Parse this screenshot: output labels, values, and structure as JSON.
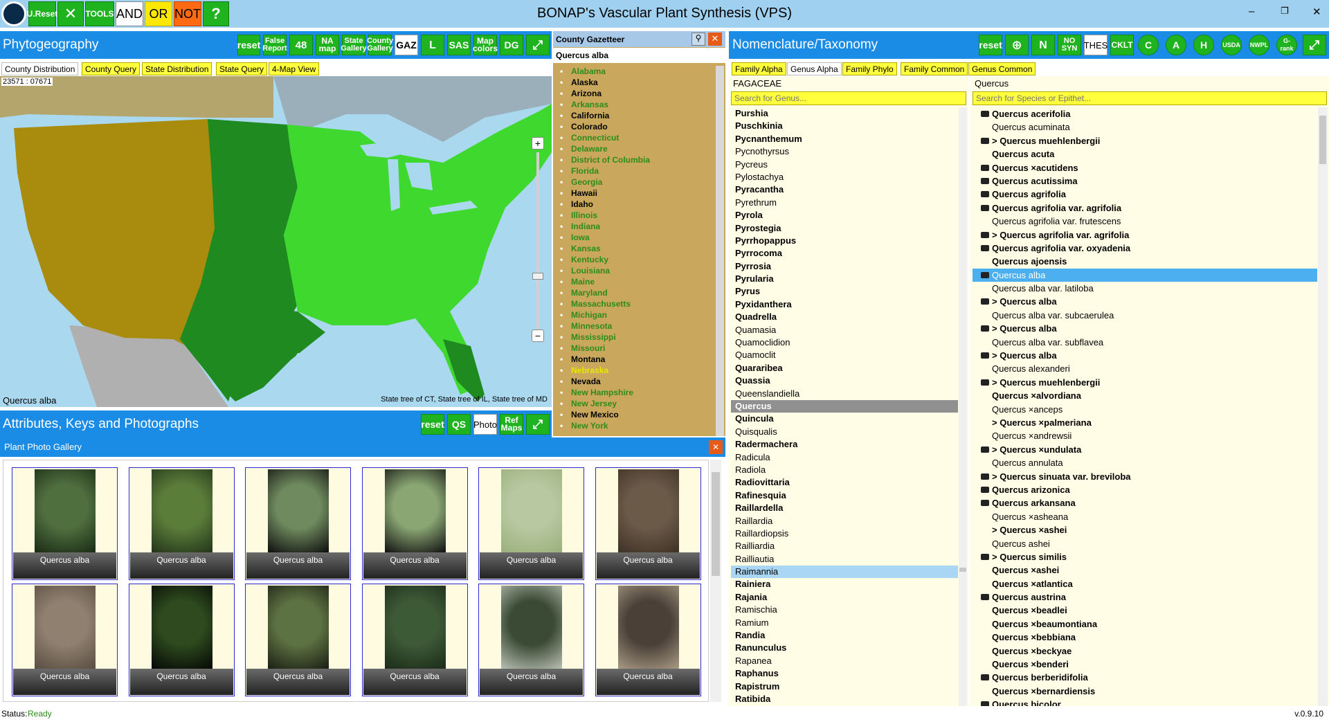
{
  "app": {
    "title": "BONAP's Vascular Plant Synthesis (VPS)",
    "version": "v.0.9.10"
  },
  "toolbar": {
    "ureset": "U.Reset",
    "tools": "TOOLS",
    "and": "AND",
    "or": "OR",
    "not": "NOT",
    "help": "?"
  },
  "window_controls": {
    "minimize": "–",
    "restore": "❐",
    "close": "✕"
  },
  "phyto": {
    "title": "Phytogeography",
    "buttons": [
      "reset",
      "False Report",
      "48",
      "NA map",
      "State Gallery",
      "County Gallery",
      "GAZ",
      "L",
      "SAS",
      "Map colors",
      "DG"
    ],
    "tabs": [
      "County Distribution",
      "County Query",
      "State Distribution",
      "State Query",
      "4-Map View"
    ],
    "coords": "23571 : 07671",
    "species": "Quercus alba",
    "note": "State tree of CT, State tree of IL, State tree of MD"
  },
  "gazetteer": {
    "title": "County Gazetteer",
    "species": "Quercus alba",
    "states": [
      {
        "name": "Alabama",
        "c": "#2e8b1a"
      },
      {
        "name": "Alaska",
        "c": "#000"
      },
      {
        "name": "Arizona",
        "c": "#000"
      },
      {
        "name": "Arkansas",
        "c": "#2e8b1a"
      },
      {
        "name": "California",
        "c": "#000"
      },
      {
        "name": "Colorado",
        "c": "#000"
      },
      {
        "name": "Connecticut",
        "c": "#2e8b1a"
      },
      {
        "name": "Delaware",
        "c": "#2e8b1a"
      },
      {
        "name": "District of Columbia",
        "c": "#2e8b1a"
      },
      {
        "name": "Florida",
        "c": "#2e8b1a"
      },
      {
        "name": "Georgia",
        "c": "#2e8b1a"
      },
      {
        "name": "Hawaii",
        "c": "#000"
      },
      {
        "name": "Idaho",
        "c": "#000"
      },
      {
        "name": "Illinois",
        "c": "#2e8b1a"
      },
      {
        "name": "Indiana",
        "c": "#2e8b1a"
      },
      {
        "name": "Iowa",
        "c": "#2e8b1a"
      },
      {
        "name": "Kansas",
        "c": "#2e8b1a"
      },
      {
        "name": "Kentucky",
        "c": "#2e8b1a"
      },
      {
        "name": "Louisiana",
        "c": "#2e8b1a"
      },
      {
        "name": "Maine",
        "c": "#2e8b1a"
      },
      {
        "name": "Maryland",
        "c": "#2e8b1a"
      },
      {
        "name": "Massachusetts",
        "c": "#2e8b1a"
      },
      {
        "name": "Michigan",
        "c": "#2e8b1a"
      },
      {
        "name": "Minnesota",
        "c": "#2e8b1a"
      },
      {
        "name": "Mississippi",
        "c": "#2e8b1a"
      },
      {
        "name": "Missouri",
        "c": "#2e8b1a"
      },
      {
        "name": "Montana",
        "c": "#000"
      },
      {
        "name": "Nebraska",
        "c": "#e8e800"
      },
      {
        "name": "Nevada",
        "c": "#000"
      },
      {
        "name": "New Hampshire",
        "c": "#2e8b1a"
      },
      {
        "name": "New Jersey",
        "c": "#2e8b1a"
      },
      {
        "name": "New Mexico",
        "c": "#000"
      },
      {
        "name": "New York",
        "c": "#2e8b1a"
      }
    ]
  },
  "attributes": {
    "title": "Attributes, Keys and Photographs",
    "buttons": [
      "reset",
      "QS",
      "Photo",
      "Ref Maps"
    ]
  },
  "gallery": {
    "title": "Plant Photo Gallery",
    "photos": [
      {
        "caption": "Quercus alba",
        "c1": "#4f6f3f",
        "c2": "#1a2a14"
      },
      {
        "caption": "Quercus alba",
        "c1": "#5a7d3a",
        "c2": "#24341a"
      },
      {
        "caption": "Quercus alba",
        "c1": "#6f8a5e",
        "c2": "#0e0e0e"
      },
      {
        "caption": "Quercus alba",
        "c1": "#8aa673",
        "c2": "#101010"
      },
      {
        "caption": "Quercus alba",
        "c1": "#b8c8a0",
        "c2": "#9ab07c"
      },
      {
        "caption": "Quercus alba",
        "c1": "#6b5a48",
        "c2": "#3e3126"
      },
      {
        "caption": "Quercus alba",
        "c1": "#8f8070",
        "c2": "#5a4e42"
      },
      {
        "caption": "Quercus alba",
        "c1": "#2e4a1e",
        "c2": "#050805"
      },
      {
        "caption": "Quercus alba",
        "c1": "#5d7242",
        "c2": "#1a1f14"
      },
      {
        "caption": "Quercus alba",
        "c1": "#3d5a36",
        "c2": "#1c2a1a"
      },
      {
        "caption": "Quercus alba",
        "c1": "#3a4a34",
        "c2": "#b9c0b4"
      },
      {
        "caption": "Quercus alba",
        "c1": "#4a4038",
        "c2": "#a89a84"
      }
    ]
  },
  "nomen": {
    "title": "Nomenclature/Taxonomy",
    "buttons": [
      "reset",
      "N",
      "NO SYN",
      "THES",
      "CKLT",
      "C",
      "A",
      "H",
      "USDA",
      "NWPL",
      "G-rank"
    ],
    "tabs": [
      "Family Alpha",
      "Genus Alpha",
      "Family Phylo",
      "Family Common",
      "Genus Common"
    ],
    "family": "FAGACEAE",
    "genus_placeholder": "Search for Genus...",
    "genus_selected": "Quercus",
    "species_placeholder": "Search for Species or Epithet...",
    "genera": [
      {
        "n": "Purshia",
        "b": true
      },
      {
        "n": "Puschkinia",
        "b": true
      },
      {
        "n": "Pycnanthemum",
        "b": true
      },
      {
        "n": "Pycnothyrsus",
        "b": false
      },
      {
        "n": "Pycreus",
        "b": false
      },
      {
        "n": "Pylostachya",
        "b": false
      },
      {
        "n": "Pyracantha",
        "b": true
      },
      {
        "n": "Pyrethrum",
        "b": false
      },
      {
        "n": "Pyrola",
        "b": true
      },
      {
        "n": "Pyrostegia",
        "b": true
      },
      {
        "n": "Pyrrhopappus",
        "b": true
      },
      {
        "n": "Pyrrocoma",
        "b": true
      },
      {
        "n": "Pyrrosia",
        "b": true
      },
      {
        "n": "Pyrularia",
        "b": true
      },
      {
        "n": "Pyrus",
        "b": true
      },
      {
        "n": "Pyxidanthera",
        "b": true
      },
      {
        "n": "Quadrella",
        "b": true
      },
      {
        "n": "Quamasia",
        "b": false
      },
      {
        "n": "Quamoclidion",
        "b": false
      },
      {
        "n": "Quamoclit",
        "b": false
      },
      {
        "n": "Quararibea",
        "b": true
      },
      {
        "n": "Quassia",
        "b": true
      },
      {
        "n": "Queenslandiella",
        "b": false
      },
      {
        "n": "Quercus",
        "b": true,
        "sel": true
      },
      {
        "n": "Quincula",
        "b": true
      },
      {
        "n": "Quisqualis",
        "b": false
      },
      {
        "n": "Radermachera",
        "b": true
      },
      {
        "n": "Radicula",
        "b": false
      },
      {
        "n": "Radiola",
        "b": false
      },
      {
        "n": "Radiovittaria",
        "b": true
      },
      {
        "n": "Rafinesquia",
        "b": true
      },
      {
        "n": "Raillardella",
        "b": true
      },
      {
        "n": "Raillardia",
        "b": false
      },
      {
        "n": "Raillardiopsis",
        "b": false
      },
      {
        "n": "Railliardia",
        "b": false
      },
      {
        "n": "Railliautia",
        "b": false
      },
      {
        "n": "Raimannia",
        "b": false,
        "hl": true
      },
      {
        "n": "Rainiera",
        "b": true
      },
      {
        "n": "Rajania",
        "b": true
      },
      {
        "n": "Ramischia",
        "b": false
      },
      {
        "n": "Ramium",
        "b": false
      },
      {
        "n": "Randia",
        "b": true
      },
      {
        "n": "Ranunculus",
        "b": true
      },
      {
        "n": "Rapanea",
        "b": false
      },
      {
        "n": "Raphanus",
        "b": true
      },
      {
        "n": "Rapistrum",
        "b": true
      },
      {
        "n": "Ratibida",
        "b": true
      }
    ],
    "species": [
      {
        "n": "Quercus acerifolia",
        "cam": true,
        "b": true
      },
      {
        "n": "Quercus acuminata",
        "cam": false,
        "b": false
      },
      {
        "n": "> Quercus muehlenbergii",
        "cam": true,
        "b": true
      },
      {
        "n": "Quercus acuta",
        "cam": false,
        "b": true
      },
      {
        "n": "Quercus ×acutidens",
        "cam": true,
        "b": true
      },
      {
        "n": "Quercus acutissima",
        "cam": true,
        "b": true
      },
      {
        "n": "Quercus agrifolia",
        "cam": true,
        "b": true
      },
      {
        "n": "Quercus agrifolia var. agrifolia",
        "cam": true,
        "b": true
      },
      {
        "n": "Quercus agrifolia var. frutescens",
        "cam": false,
        "b": false
      },
      {
        "n": "> Quercus agrifolia var. agrifolia",
        "cam": true,
        "b": true
      },
      {
        "n": "Quercus agrifolia var. oxyadenia",
        "cam": true,
        "b": true
      },
      {
        "n": "Quercus ajoensis",
        "cam": false,
        "b": true
      },
      {
        "n": "Quercus alba",
        "cam": true,
        "b": false,
        "sel": true
      },
      {
        "n": "Quercus alba var. latiloba",
        "cam": false,
        "b": false
      },
      {
        "n": "> Quercus alba",
        "cam": true,
        "b": true
      },
      {
        "n": "Quercus alba var. subcaerulea",
        "cam": false,
        "b": false
      },
      {
        "n": "> Quercus alba",
        "cam": true,
        "b": true
      },
      {
        "n": "Quercus alba var. subflavea",
        "cam": false,
        "b": false
      },
      {
        "n": "> Quercus alba",
        "cam": true,
        "b": true
      },
      {
        "n": "Quercus alexanderi",
        "cam": false,
        "b": false
      },
      {
        "n": "> Quercus muehlenbergii",
        "cam": true,
        "b": true
      },
      {
        "n": "Quercus ×alvordiana",
        "cam": false,
        "b": true
      },
      {
        "n": "Quercus ×anceps",
        "cam": false,
        "b": false
      },
      {
        "n": "> Quercus ×palmeriana",
        "cam": false,
        "b": true
      },
      {
        "n": "Quercus ×andrewsii",
        "cam": false,
        "b": false
      },
      {
        "n": "> Quercus ×undulata",
        "cam": true,
        "b": true
      },
      {
        "n": "Quercus annulata",
        "cam": false,
        "b": false
      },
      {
        "n": "> Quercus sinuata var. breviloba",
        "cam": true,
        "b": true
      },
      {
        "n": "Quercus arizonica",
        "cam": true,
        "b": true
      },
      {
        "n": "Quercus arkansana",
        "cam": true,
        "b": true
      },
      {
        "n": "Quercus ×asheana",
        "cam": false,
        "b": false
      },
      {
        "n": "> Quercus ×ashei",
        "cam": false,
        "b": true
      },
      {
        "n": "Quercus ashei",
        "cam": false,
        "b": false
      },
      {
        "n": "> Quercus similis",
        "cam": true,
        "b": true
      },
      {
        "n": "Quercus ×ashei",
        "cam": false,
        "b": true
      },
      {
        "n": "Quercus ×atlantica",
        "cam": false,
        "b": true
      },
      {
        "n": "Quercus austrina",
        "cam": true,
        "b": true
      },
      {
        "n": "Quercus ×beadlei",
        "cam": false,
        "b": true
      },
      {
        "n": "Quercus ×beaumontiana",
        "cam": false,
        "b": true
      },
      {
        "n": "Quercus ×bebbiana",
        "cam": false,
        "b": true
      },
      {
        "n": "Quercus ×beckyae",
        "cam": false,
        "b": true
      },
      {
        "n": "Quercus ×benderi",
        "cam": false,
        "b": true
      },
      {
        "n": "Quercus berberidifolia",
        "cam": true,
        "b": true
      },
      {
        "n": "Quercus ×bernardiensis",
        "cam": false,
        "b": true
      },
      {
        "n": "Quercus bicolor",
        "cam": true,
        "b": true
      }
    ]
  },
  "status": {
    "label": "Status:",
    "value": "Ready"
  }
}
